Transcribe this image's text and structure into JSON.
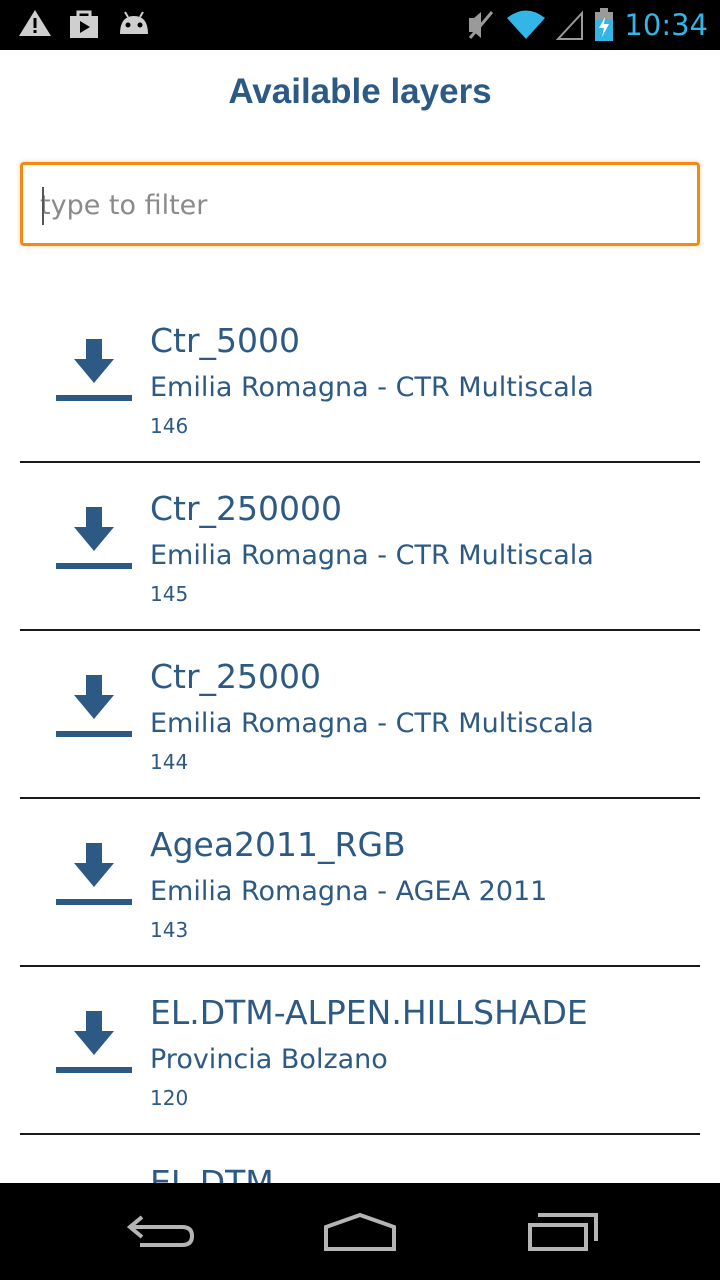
{
  "status_bar": {
    "time": "10:34",
    "left_icons": [
      "warning-icon",
      "play-store-icon",
      "android-icon"
    ],
    "right_icons": [
      "mute-icon",
      "wifi-icon",
      "signal-icon",
      "battery-charging-icon"
    ],
    "accent_color": "#33b5e5"
  },
  "header": {
    "title": "Available layers"
  },
  "filter": {
    "placeholder": "type to filter",
    "value": ""
  },
  "layers": [
    {
      "name": "Ctr_5000",
      "source": "Emilia Romagna - CTR Multiscala",
      "id": "146",
      "icon": "download-icon"
    },
    {
      "name": "Ctr_250000",
      "source": "Emilia Romagna - CTR Multiscala",
      "id": "145",
      "icon": "download-icon"
    },
    {
      "name": "Ctr_25000",
      "source": "Emilia Romagna - CTR Multiscala",
      "id": "144",
      "icon": "download-icon"
    },
    {
      "name": "Agea2011_RGB",
      "source": "Emilia Romagna - AGEA 2011",
      "id": "143",
      "icon": "download-icon"
    },
    {
      "name": "EL.DTM-ALPEN.HILLSHADE",
      "source": "Provincia Bolzano",
      "id": "120",
      "icon": "download-icon"
    }
  ],
  "partial_layer": {
    "name": "EL.DTM"
  },
  "nav_bar": {
    "buttons": [
      "back-icon",
      "home-icon",
      "recent-apps-icon"
    ]
  },
  "colors": {
    "text": "#2d5a84",
    "focus_border": "#f28a15"
  }
}
